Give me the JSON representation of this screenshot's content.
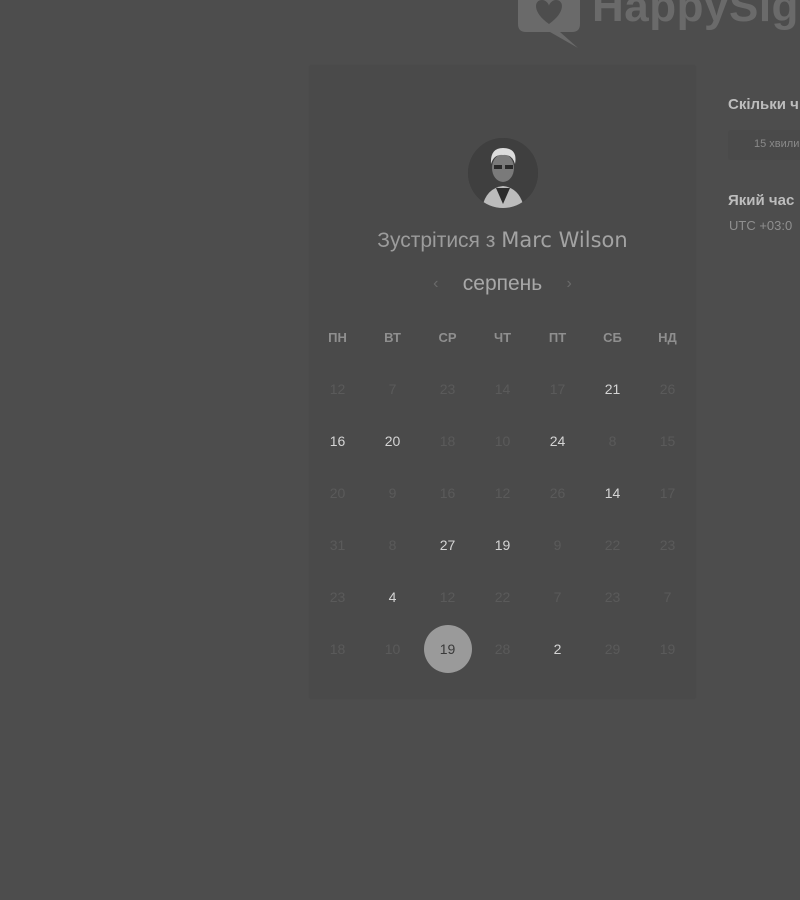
{
  "brand": {
    "name": "HappySig"
  },
  "calendar": {
    "meet_prefix": "Зустрітися з",
    "host": "Marc Wilson",
    "month": "серпень",
    "prev_icon": "chevron-left-icon",
    "next_icon": "chevron-right-icon",
    "weekdays": [
      "ПН",
      "ВТ",
      "СР",
      "ЧТ",
      "ПТ",
      "СБ",
      "НД"
    ],
    "weeks": [
      [
        {
          "d": "12",
          "a": false
        },
        {
          "d": "7",
          "a": false
        },
        {
          "d": "23",
          "a": false
        },
        {
          "d": "14",
          "a": false
        },
        {
          "d": "17",
          "a": false
        },
        {
          "d": "21",
          "a": true
        },
        {
          "d": "26",
          "a": false
        }
      ],
      [
        {
          "d": "16",
          "a": true
        },
        {
          "d": "20",
          "a": true
        },
        {
          "d": "18",
          "a": false
        },
        {
          "d": "10",
          "a": false
        },
        {
          "d": "24",
          "a": true
        },
        {
          "d": "8",
          "a": false
        },
        {
          "d": "15",
          "a": false
        }
      ],
      [
        {
          "d": "20",
          "a": false
        },
        {
          "d": "9",
          "a": false
        },
        {
          "d": "16",
          "a": false
        },
        {
          "d": "12",
          "a": false
        },
        {
          "d": "26",
          "a": false
        },
        {
          "d": "14",
          "a": true
        },
        {
          "d": "17",
          "a": false
        }
      ],
      [
        {
          "d": "31",
          "a": false
        },
        {
          "d": "8",
          "a": false
        },
        {
          "d": "27",
          "a": true
        },
        {
          "d": "19",
          "a": true
        },
        {
          "d": "9",
          "a": false
        },
        {
          "d": "22",
          "a": false
        },
        {
          "d": "23",
          "a": false
        }
      ],
      [
        {
          "d": "23",
          "a": false
        },
        {
          "d": "4",
          "a": true
        },
        {
          "d": "12",
          "a": false
        },
        {
          "d": "22",
          "a": false
        },
        {
          "d": "7",
          "a": false
        },
        {
          "d": "23",
          "a": false
        },
        {
          "d": "7",
          "a": false
        }
      ],
      [
        {
          "d": "18",
          "a": false
        },
        {
          "d": "10",
          "a": false
        },
        {
          "d": "19",
          "a": true,
          "s": true
        },
        {
          "d": "28",
          "a": false
        },
        {
          "d": "2",
          "a": true
        },
        {
          "d": "29",
          "a": false
        },
        {
          "d": "19",
          "a": false
        }
      ]
    ]
  },
  "side": {
    "duration_question": "Скільки ч",
    "duration_value": "15 хвили",
    "time_question": "Який час",
    "timezone": "UTC +03:0"
  },
  "colors": {
    "background": "#4d4d4d",
    "selected_day": "#9a9a9a"
  }
}
